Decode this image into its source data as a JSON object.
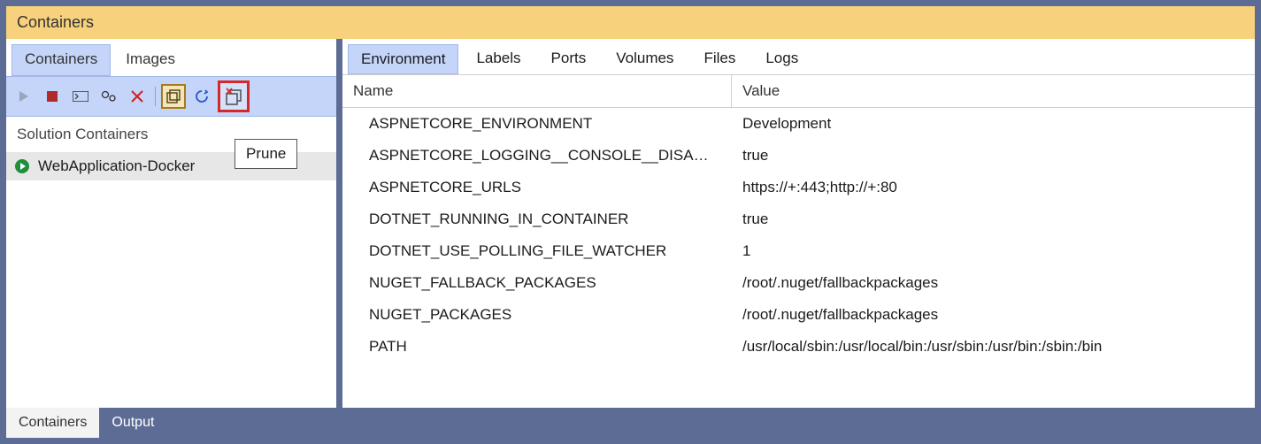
{
  "title": "Containers",
  "leftTabs": [
    {
      "label": "Containers",
      "active": true
    },
    {
      "label": "Images",
      "active": false
    }
  ],
  "sectionHeader": "Solution Containers",
  "tooltip": "Prune",
  "items": [
    {
      "label": "WebApplication-Docker",
      "running": true
    }
  ],
  "rightTabs": [
    {
      "label": "Environment",
      "active": true
    },
    {
      "label": "Labels",
      "active": false
    },
    {
      "label": "Ports",
      "active": false
    },
    {
      "label": "Volumes",
      "active": false
    },
    {
      "label": "Files",
      "active": false
    },
    {
      "label": "Logs",
      "active": false
    }
  ],
  "columns": {
    "name": "Name",
    "value": "Value"
  },
  "env": [
    {
      "name": "ASPNETCORE_ENVIRONMENT",
      "value": "Development"
    },
    {
      "name": "ASPNETCORE_LOGGING__CONSOLE__DISA…",
      "value": "true"
    },
    {
      "name": "ASPNETCORE_URLS",
      "value": "https://+:443;http://+:80"
    },
    {
      "name": "DOTNET_RUNNING_IN_CONTAINER",
      "value": "true"
    },
    {
      "name": "DOTNET_USE_POLLING_FILE_WATCHER",
      "value": "1"
    },
    {
      "name": "NUGET_FALLBACK_PACKAGES",
      "value": "/root/.nuget/fallbackpackages"
    },
    {
      "name": "NUGET_PACKAGES",
      "value": "/root/.nuget/fallbackpackages"
    },
    {
      "name": "PATH",
      "value": "/usr/local/sbin:/usr/local/bin:/usr/sbin:/usr/bin:/sbin:/bin"
    }
  ],
  "bottomTabs": [
    {
      "label": "Containers",
      "active": true
    },
    {
      "label": "Output",
      "active": false
    }
  ]
}
